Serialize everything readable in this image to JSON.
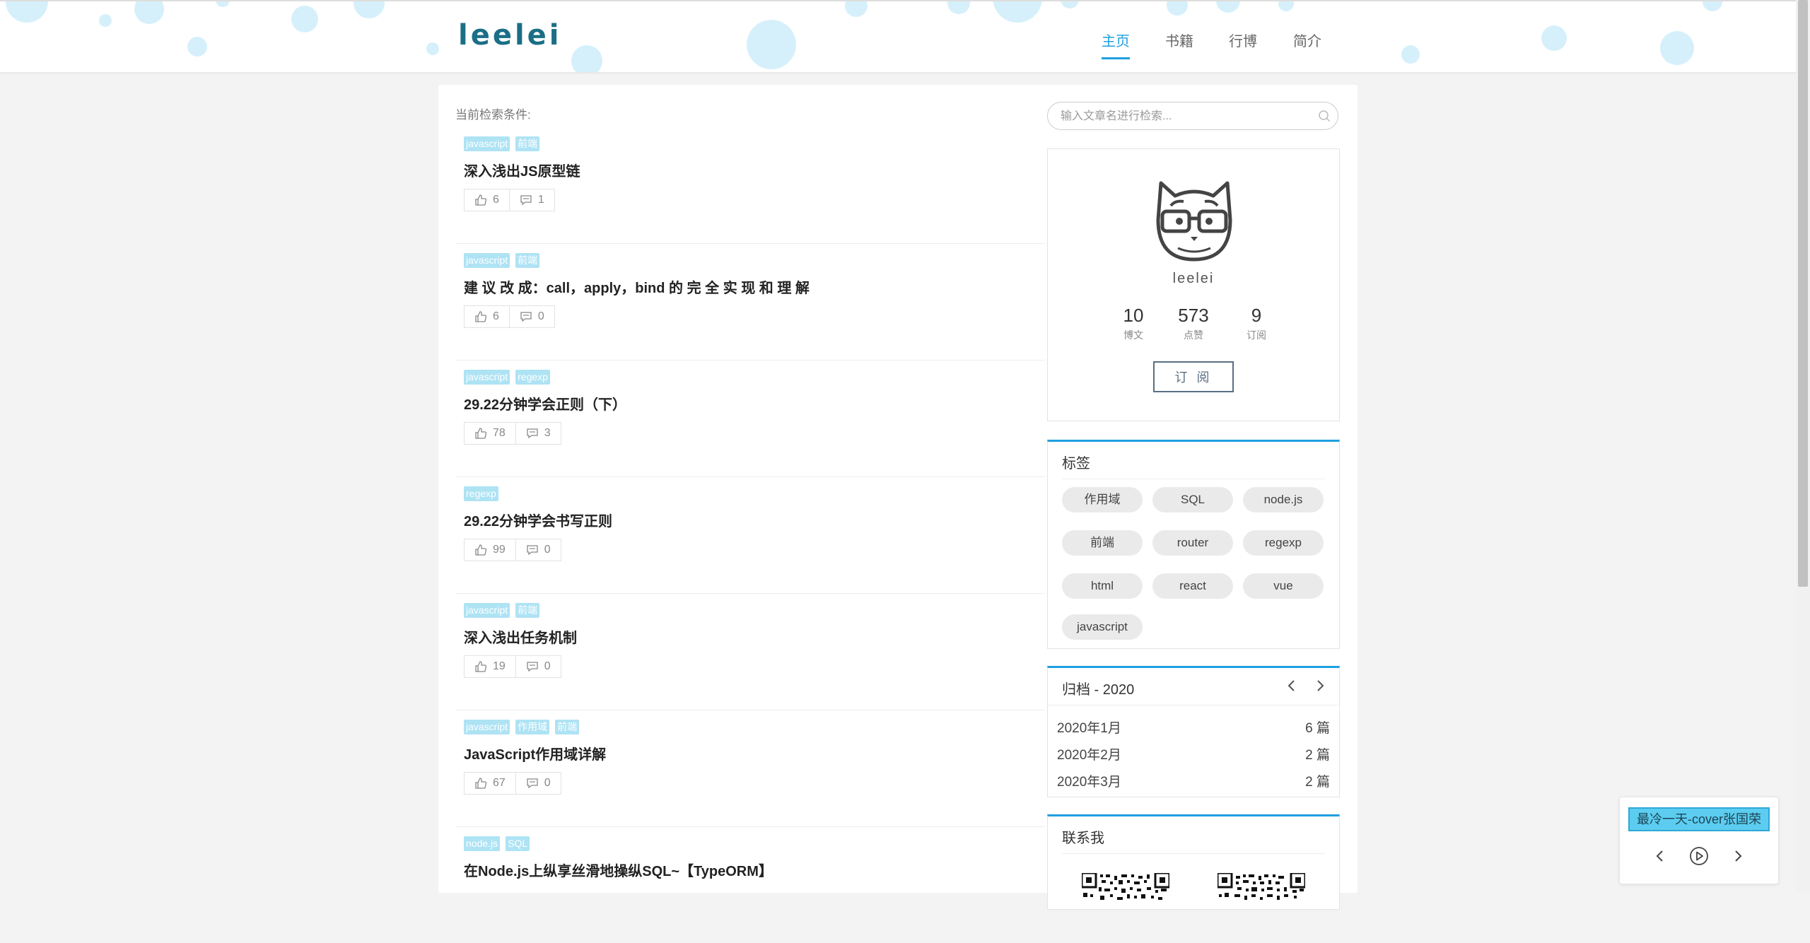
{
  "header": {
    "logo": "leelei",
    "nav": [
      {
        "label": "主页",
        "active": true
      },
      {
        "label": "书籍",
        "active": false
      },
      {
        "label": "行博",
        "active": false
      },
      {
        "label": "简介",
        "active": false
      }
    ]
  },
  "main": {
    "search_condition_label": "当前检索条件:",
    "posts": [
      {
        "tags": [
          "javascript",
          "前端"
        ],
        "title": "深入浅出JS原型链",
        "likes": "6",
        "comments": "1"
      },
      {
        "tags": [
          "javascript",
          "前端"
        ],
        "title": "建 议 改 成：call，apply，bind 的 完 全 实 现 和 理 解",
        "likes": "6",
        "comments": "0"
      },
      {
        "tags": [
          "javascript",
          "regexp"
        ],
        "title": "29.22分钟学会正则（下）",
        "likes": "78",
        "comments": "3"
      },
      {
        "tags": [
          "regexp"
        ],
        "title": "29.22分钟学会书写正则",
        "likes": "99",
        "comments": "0"
      },
      {
        "tags": [
          "javascript",
          "前端"
        ],
        "title": "深入浅出任务机制",
        "likes": "19",
        "comments": "0"
      },
      {
        "tags": [
          "javascript",
          "作用域",
          "前端"
        ],
        "title": "JavaScript作用域详解",
        "likes": "67",
        "comments": "0"
      },
      {
        "tags": [
          "node.js",
          "SQL"
        ],
        "title": "在Node.js上纵享丝滑地操纵SQL~【TypeORM】",
        "likes": "",
        "comments": ""
      }
    ]
  },
  "sidebar": {
    "search_placeholder": "输入文章名进行检索...",
    "profile": {
      "username": "leelei",
      "stats": [
        {
          "value": "10",
          "label": "博文"
        },
        {
          "value": "573",
          "label": "点赞"
        },
        {
          "value": "9",
          "label": "订阅"
        }
      ],
      "subscribe_label": "订 阅"
    },
    "tags_box": {
      "title": "标签",
      "tags": [
        "作用域",
        "SQL",
        "node.js",
        "前端",
        "router",
        "regexp",
        "html",
        "react",
        "vue",
        "javascript"
      ]
    },
    "archive": {
      "title": "归档 - 2020",
      "rows": [
        {
          "month": "2020年1月",
          "count": "6 篇"
        },
        {
          "month": "2020年2月",
          "count": "2 篇"
        },
        {
          "month": "2020年3月",
          "count": "2 篇"
        }
      ]
    },
    "contact": {
      "title": "联系我"
    }
  },
  "player": {
    "song": "最冷一天-cover张国荣"
  },
  "colors": {
    "accent": "#1e9fe0",
    "tag_bg": "#aee3f4",
    "logo": "#1a6f86"
  }
}
